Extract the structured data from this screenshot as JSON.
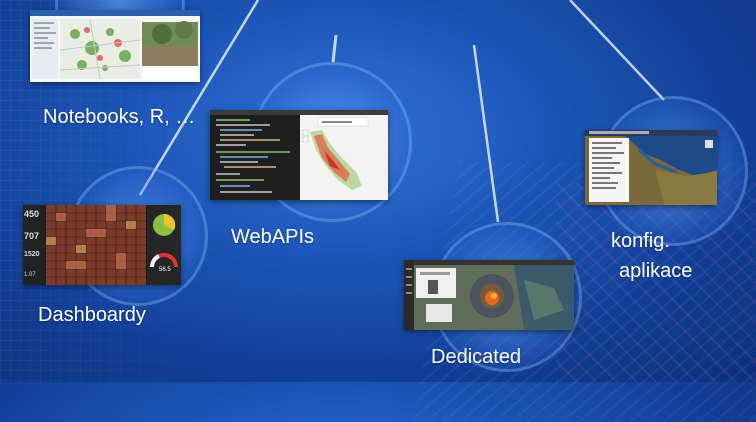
{
  "nodes": {
    "notebooks": {
      "label": "Notebooks, R, …"
    },
    "dashboardy": {
      "label": "Dashboardy",
      "counters": [
        "450",
        "707",
        "1520",
        "1.07"
      ],
      "gauge": "56.5"
    },
    "webapis": {
      "label": "WebAPIs"
    },
    "dedicated": {
      "label": "Dedicated"
    },
    "konfig": {
      "label_line1": "konfig.",
      "label_line2": "aplikace"
    }
  }
}
